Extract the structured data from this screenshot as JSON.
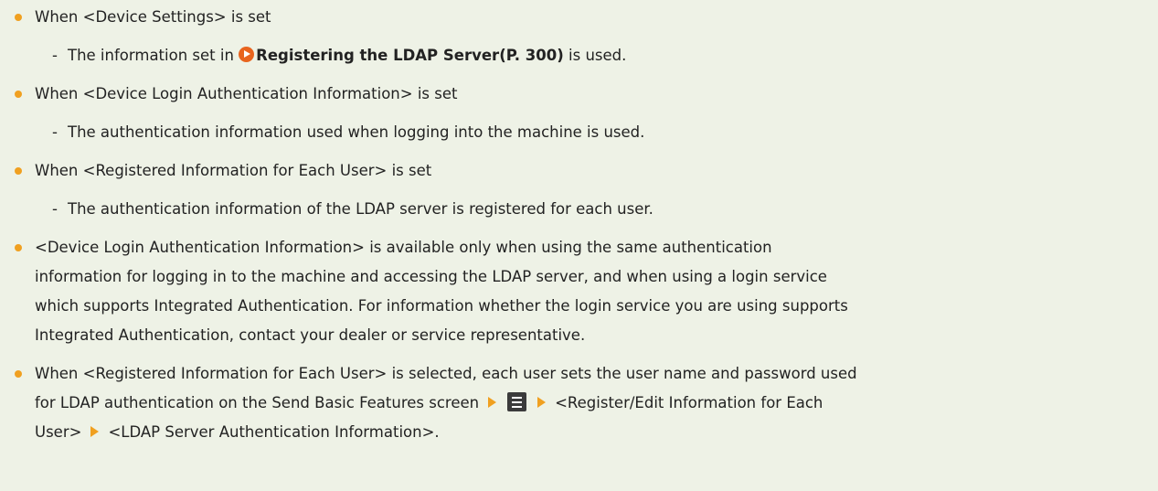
{
  "items": [
    {
      "text": "When <Device Settings> is set",
      "sub": {
        "prefix": "The information set in ",
        "link": "Registering the LDAP Server(P. 300)",
        "suffix": " is used."
      }
    },
    {
      "text": "When <Device Login Authentication Information> is set",
      "sub": {
        "text": "The authentication information used when logging into the machine is used."
      }
    },
    {
      "text": "When <Registered Information for Each User> is set",
      "sub": {
        "text": "The authentication information of the LDAP server is registered for each user."
      }
    }
  ],
  "note1": {
    "line1": "<Device Login Authentication Information> is available only when using the same authentication",
    "line2": "information for logging in to the machine and accessing the LDAP server, and when using a login service",
    "line3": "which supports Integrated Authentication. For information whether the login service you are using supports",
    "line4": "Integrated Authentication, contact your dealer or service representative."
  },
  "note2": {
    "line1": "When <Registered Information for Each User> is selected, each user sets the user name and password used",
    "line2_prefix": "for LDAP authentication on the Send Basic Features screen",
    "line2_suffix": "<Register/Edit Information for Each",
    "line3_prefix": "User>",
    "line3_suffix": "<LDAP Server Authentication Information>."
  },
  "icons": {
    "bullet": "bullet-dot",
    "link": "link-arrow-icon",
    "step_arrow": "step-arrow-icon",
    "menu": "menu-icon"
  },
  "colors": {
    "background": "#eef2e6",
    "bullet": "#f0a020",
    "link_icon": "#e8641e",
    "menu_icon": "#3b3b3b"
  }
}
